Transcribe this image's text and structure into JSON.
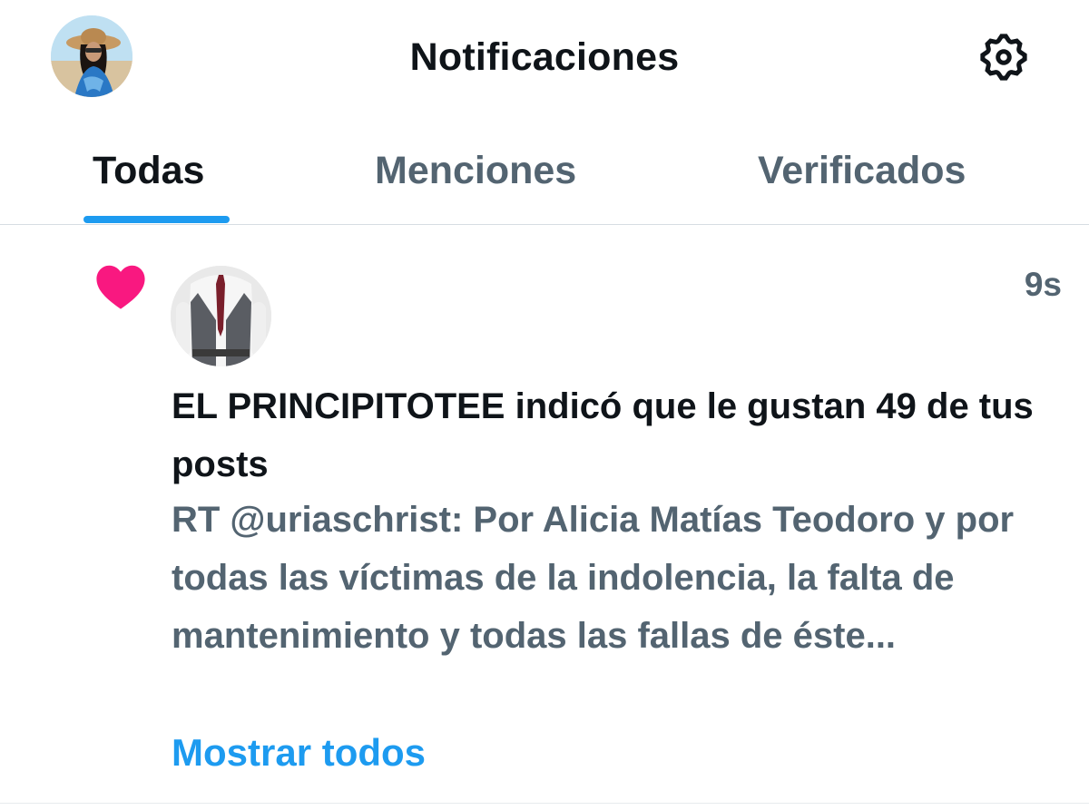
{
  "header": {
    "title": "Notificaciones",
    "avatar_icon": "profile-photo",
    "settings_icon": "gear-icon"
  },
  "tabs": [
    {
      "label": "Todas",
      "active": true
    },
    {
      "label": "Menciones",
      "active": false
    },
    {
      "label": "Verificados",
      "active": false
    }
  ],
  "notification": {
    "type_icon": "heart-icon",
    "type_color": "#f91880",
    "time": "9s",
    "text": "EL PRINCIPITOTEE indicó que le gustan 49 de tus posts",
    "preview": "RT @uriaschrist: Por Alicia Matías Teodoro y por todas las víctimas de la indolencia, la falta de mantenimiento y todas las fallas de éste...",
    "show_all_label": "Mostrar todos"
  },
  "colors": {
    "accent": "#1d9bf0",
    "text_primary": "#0f1419",
    "text_secondary": "#536471",
    "like": "#f91880"
  }
}
